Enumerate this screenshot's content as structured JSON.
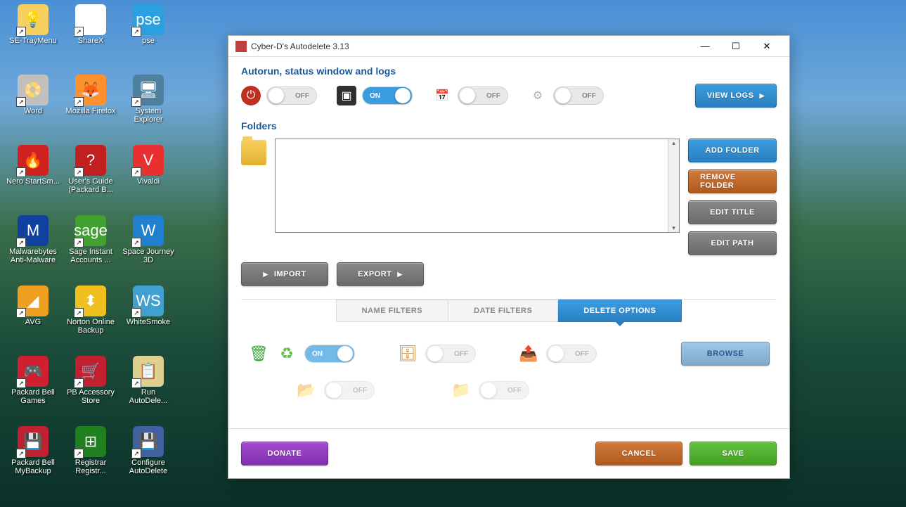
{
  "desktop_icons": [
    {
      "label": "SE-TrayMenu",
      "bg": "#f8d060",
      "glyph": "💡"
    },
    {
      "label": "ShareX",
      "bg": "#ffffff",
      "glyph": "◯"
    },
    {
      "label": "pse",
      "bg": "#2aa0e0",
      "glyph": "pse"
    },
    {
      "label": "Word",
      "bg": "#c0c0c0",
      "glyph": "📀"
    },
    {
      "label": "Mozilla Firefox",
      "bg": "#ff9030",
      "glyph": "🦊"
    },
    {
      "label": "System Explorer",
      "bg": "#5080a0",
      "glyph": "🖥"
    },
    {
      "label": "Nero StartSm...",
      "bg": "#d02020",
      "glyph": "🔥"
    },
    {
      "label": "User's Guide (Packard B...",
      "bg": "#c02020",
      "glyph": "?"
    },
    {
      "label": "Vivaldi",
      "bg": "#e83030",
      "glyph": "V"
    },
    {
      "label": "Malwarebytes Anti-Malware",
      "bg": "#1040a0",
      "glyph": "M"
    },
    {
      "label": "Sage Instant Accounts ...",
      "bg": "#40a030",
      "glyph": "sage"
    },
    {
      "label": "Space Journey 3D",
      "bg": "#2080d0",
      "glyph": "W"
    },
    {
      "label": "AVG",
      "bg": "#f0a020",
      "glyph": "◢"
    },
    {
      "label": "Norton Online Backup",
      "bg": "#f0c020",
      "glyph": "⬍"
    },
    {
      "label": "WhiteSmoke",
      "bg": "#40a0d0",
      "glyph": "WS"
    },
    {
      "label": "Packard Bell Games",
      "bg": "#d02030",
      "glyph": "🎮"
    },
    {
      "label": "PB Accessory Store",
      "bg": "#c02030",
      "glyph": "🛒"
    },
    {
      "label": "Run AutoDele...",
      "bg": "#e0d090",
      "glyph": "📋"
    },
    {
      "label": "Packard Bell MyBackup",
      "bg": "#c02030",
      "glyph": "💾"
    },
    {
      "label": "Registrar Registr...",
      "bg": "#208020",
      "glyph": "⊞"
    },
    {
      "label": "Configure AutoDelete",
      "bg": "#4060a0",
      "glyph": "💾"
    }
  ],
  "window": {
    "title": "Cyber-D's Autodelete 3.13",
    "section_autorun": "Autorun, status window and logs",
    "toggles": {
      "power": "OFF",
      "terminal": "ON",
      "calendar": "OFF",
      "gear": "OFF"
    },
    "view_logs": "VIEW LOGS",
    "section_folders": "Folders",
    "add_folder": "ADD FOLDER",
    "remove_folder": "REMOVE FOLDER",
    "edit_title": "EDIT TITLE",
    "edit_path": "EDIT PATH",
    "import": "IMPORT",
    "export": "EXPORT",
    "tabs": {
      "name_filters": "NAME FILTERS",
      "date_filters": "DATE FILTERS",
      "delete_options": "DELETE OPTIONS"
    },
    "opts": {
      "trash": "ON",
      "secure": "OFF",
      "move": "OFF",
      "folder1": "OFF",
      "folder2": "OFF"
    },
    "browse": "BROWSE",
    "donate": "DONATE",
    "cancel": "CANCEL",
    "save": "SAVE"
  }
}
